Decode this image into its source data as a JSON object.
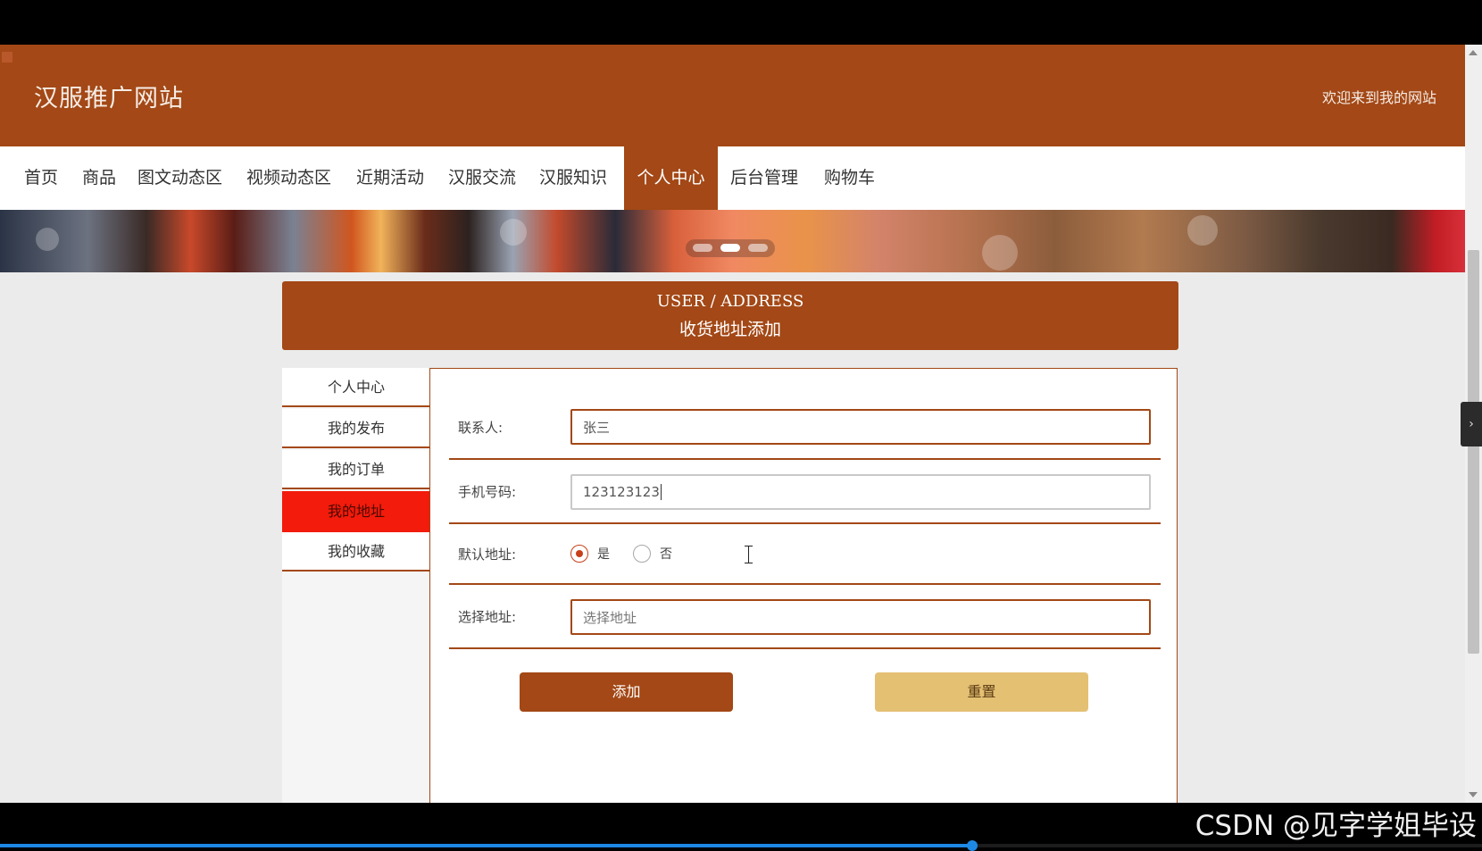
{
  "header": {
    "site_title": "汉服推广网站",
    "welcome": "欢迎来到我的网站"
  },
  "nav": {
    "items": [
      {
        "label": "首页"
      },
      {
        "label": "商品"
      },
      {
        "label": "图文动态区"
      },
      {
        "label": "视频动态区"
      },
      {
        "label": "近期活动"
      },
      {
        "label": "汉服交流"
      },
      {
        "label": "汉服知识"
      },
      {
        "label": "个人中心",
        "active": true
      },
      {
        "label": "后台管理"
      },
      {
        "label": "购物车"
      }
    ]
  },
  "banner": {
    "slides_count": 3,
    "active_slide": 2
  },
  "page_title": {
    "en": "USER / ADDRESS",
    "cn": "收货地址添加"
  },
  "sidebar": {
    "items": [
      {
        "label": "个人中心"
      },
      {
        "label": "我的发布"
      },
      {
        "label": "我的订单"
      },
      {
        "label": "我的地址",
        "active": true
      },
      {
        "label": "我的收藏"
      }
    ]
  },
  "form": {
    "contact": {
      "label": "联系人:",
      "value": "张三"
    },
    "phone": {
      "label": "手机号码:",
      "value": "123123123"
    },
    "default_address": {
      "label": "默认地址:",
      "options": [
        {
          "label": "是",
          "checked": true
        },
        {
          "label": "否",
          "checked": false
        }
      ]
    },
    "select_address": {
      "label": "选择地址:",
      "placeholder": "选择地址"
    },
    "add_label": "添加",
    "reset_label": "重置"
  },
  "video": {
    "progress_fraction": 0.656
  },
  "watermark": "CSDN @见字学姐毕设",
  "colors": {
    "brand": "#a34816",
    "active_sidebar": "#f21b0c",
    "reset_button": "#e4c073"
  }
}
